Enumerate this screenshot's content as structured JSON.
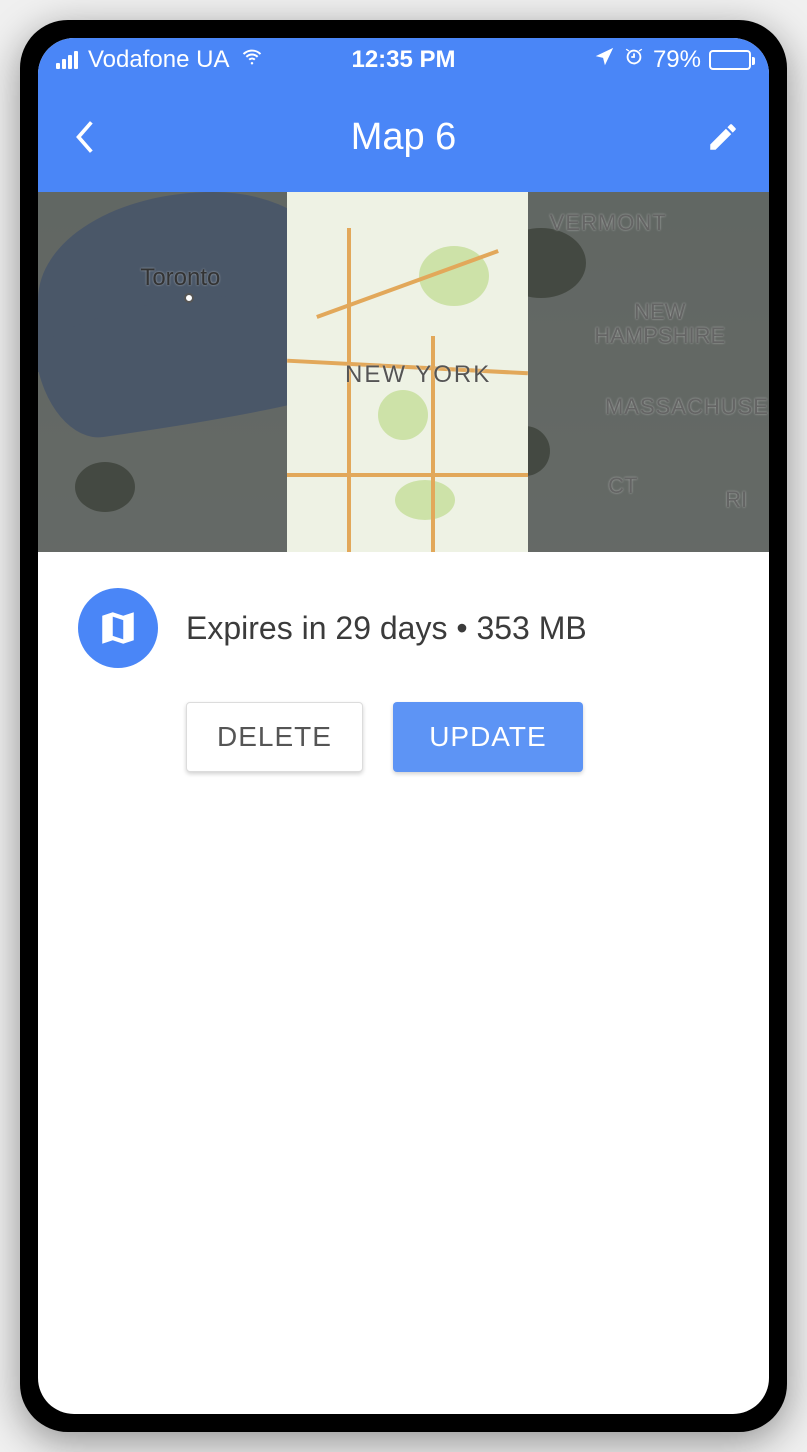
{
  "status_bar": {
    "carrier": "Vodafone UA",
    "time": "12:35 PM",
    "battery_pct": "79%"
  },
  "header": {
    "title": "Map 6"
  },
  "map": {
    "labels": {
      "new_york": "NEW YORK",
      "toronto": "Toronto",
      "vermont": "VERMONT",
      "new_hampshire": "NEW\nHAMPSHIRE",
      "massachusetts": "MASSACHUSE",
      "ct": "CT",
      "ri": "RI"
    }
  },
  "info": {
    "expiry_text": "Expires in 29 days • 353 MB"
  },
  "buttons": {
    "delete": "DELETE",
    "update": "UPDATE"
  }
}
